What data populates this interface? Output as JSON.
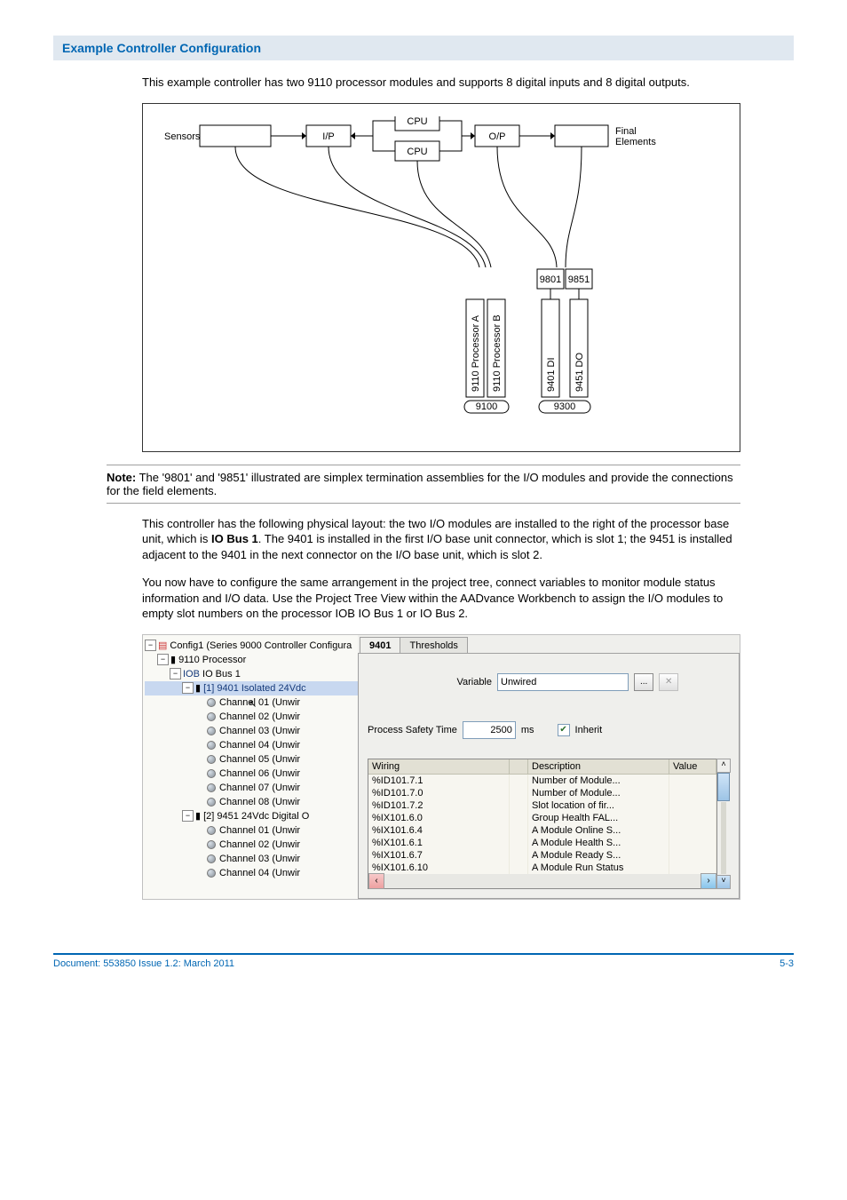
{
  "heading": "Example Controller Configuration",
  "intro": "This example controller has two 9110 processor modules and supports 8 digital inputs and 8 digital outputs.",
  "diagram": {
    "sensors": "Sensors",
    "ip": "I/P",
    "cpu": "CPU",
    "op": "O/P",
    "final1": "Final",
    "final2": "Elements",
    "term1": "9801",
    "term2": "9851",
    "procA": "9110 Processor A",
    "procB": "9110 Processor B",
    "di": "9401 DI",
    "do": "9451 DO",
    "bp1": "9100",
    "bp2": "9300"
  },
  "note_label": "Note:",
  "note_text": " The '9801' and '9851' illustrated are simplex termination assemblies for the I/O modules and provide the connections for the field elements.",
  "para1": "This controller has the following physical layout: the two I/O modules are installed to the right of the processor base unit, which is ",
  "para1_bold": "IO Bus 1",
  "para1_cont": ". The 9401 is installed in the first I/O base unit connector, which is slot 1; the 9451 is installed adjacent to the 9401 in the next connector on the I/O base unit, which is slot 2.",
  "para2": "You now have to configure the same arrangement in the project tree, connect variables to monitor module status information and I/O data. Use the Project Tree View within the AADvance Workbench to assign the I/O modules to empty slot numbers on the processor IOB IO Bus 1 or IO Bus 2.",
  "tree": {
    "root": "Config1 (Series 9000 Controller Configura",
    "proc": "9110 Processor",
    "bus_prefix": "IOB",
    "bus_label": "IO Bus 1",
    "mod1": "[1] 9401 Isolated 24Vdc",
    "mod1ch": [
      "Channel 01 (Unwir",
      "Channel 02 (Unwir",
      "Channel 03 (Unwir",
      "Channel 04 (Unwir",
      "Channel 05 (Unwir",
      "Channel 06 (Unwir",
      "Channel 07 (Unwir",
      "Channel 08 (Unwir"
    ],
    "mod2": "[2] 9451 24Vdc Digital O",
    "mod2ch": [
      "Channel 01 (Unwir",
      "Channel 02 (Unwir",
      "Channel 03 (Unwir",
      "Channel 04 (Unwir"
    ]
  },
  "tabs": {
    "t1": "9401",
    "t2": "Thresholds"
  },
  "variable_label": "Variable",
  "variable_value": "Unwired",
  "pst_label": "Process Safety Time",
  "pst_value": "2500",
  "pst_unit": "ms",
  "inherit_label": "Inherit",
  "cols": {
    "wiring": "Wiring",
    "desc": "Description",
    "value": "Value"
  },
  "rows": [
    {
      "w": "%ID101.7.1",
      "d": "Number of Module..."
    },
    {
      "w": "%ID101.7.0",
      "d": "Number of Module..."
    },
    {
      "w": "%ID101.7.2",
      "d": "Slot location of fir..."
    },
    {
      "w": "%IX101.6.0",
      "d": "Group Health FAL..."
    },
    {
      "w": "%IX101.6.4",
      "d": "A Module Online S..."
    },
    {
      "w": "%IX101.6.1",
      "d": "A Module Health S..."
    },
    {
      "w": "%IX101.6.7",
      "d": "A Module Ready S..."
    },
    {
      "w": "%IX101.6.10",
      "d": "A Module Run Status"
    }
  ],
  "footer_left": "Document: 553850 Issue 1.2: March 2011",
  "footer_right": "5-3"
}
